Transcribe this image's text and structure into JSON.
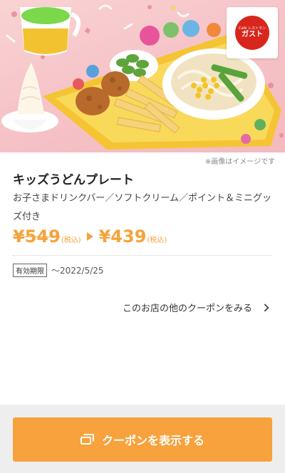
{
  "hero": {
    "image": "kids-udon-plate-photo",
    "logo": {
      "small_text": "Café レストラン",
      "big_text": "ガスト"
    }
  },
  "coupon": {
    "image_note": "※画像はイメージです",
    "title": "キッズうどんプレート",
    "description": "お子さまドリンクバー／ソフトクリーム／ポイント＆ミニグッズ付き",
    "price_old": "¥549",
    "price_old_tax": "(税込)",
    "price_new": "¥439",
    "price_new_tax": "(税込)",
    "validity_label": "有効期限",
    "validity_date": "〜2022/5/25",
    "other_coupons_link": "このお店の他のクーポンをみる"
  },
  "footer": {
    "cta_label": "クーポンを表示する",
    "cta_icon": "coupon-cards-icon"
  },
  "colors": {
    "accent": "#f7a23c",
    "brand_red": "#d9261c",
    "hero_bg": "#f6c4c8"
  }
}
